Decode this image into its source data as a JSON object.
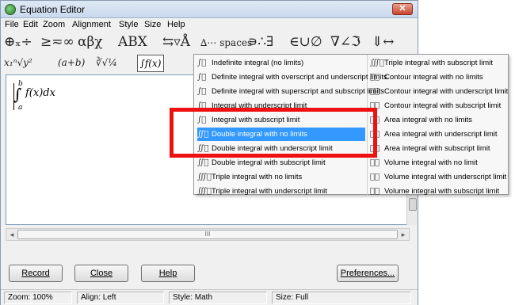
{
  "window": {
    "title": "Equation Editor",
    "close_label": "✕"
  },
  "menubar": [
    "File",
    "Edit",
    "Zoom",
    "Alignment",
    "Style",
    "Size",
    "Help"
  ],
  "palette_row1": [
    "⊕ₓ÷",
    "≥≂∞",
    "αβχ",
    "ΑΒΧ",
    "⇆▿Å",
    "∆⋯ spaces",
    "∍∴∃",
    "∈∪∅",
    "∇∠ℑ",
    "⇓↔"
  ],
  "palette_row2": [
    "x₁ⁿ√y²",
    "(a+b)",
    "∛√¼",
    "∫f(x)"
  ],
  "editor": {
    "integral": "∫",
    "upper": "b",
    "lower": "a",
    "body": "f(x)dx"
  },
  "hscroll_thumb": "III",
  "buttons": {
    "record": "Record",
    "close": "Close",
    "help": "Help",
    "preferences": "Preferences..."
  },
  "status": {
    "zoom": "Zoom: 100%",
    "align": "Align: Left",
    "style": "Style: Math",
    "size": "Size: Full"
  },
  "dropdown": {
    "left_column": [
      {
        "glyph": "∫⃞",
        "label": "Indefinite integral (no limits)"
      },
      {
        "glyph": "∫⃞",
        "label": "Definite integral with overscript and underscript limits"
      },
      {
        "glyph": "∫⃞",
        "label": "Definite integral with superscript and subscript limits"
      },
      {
        "glyph": "∫⃞",
        "label": "Integral with underscript limit"
      },
      {
        "glyph": "∫⃞",
        "label": "Integral with subscript limit"
      },
      {
        "glyph": "∬⃞",
        "label": "Double integral with no limits"
      },
      {
        "glyph": "∬⃞",
        "label": "Double integral with underscript limit"
      },
      {
        "glyph": "∬⃞",
        "label": "Double integral with subscript limit"
      },
      {
        "glyph": "∭⃞",
        "label": "Triple integral with no limits"
      },
      {
        "glyph": "∭⃞",
        "label": "Triple integral with underscript limit"
      }
    ],
    "right_column": [
      {
        "glyph": "∭⃞",
        "label": "Triple integral with subscript limit"
      },
      {
        "glyph": "∮⃞",
        "label": "Contour integral with no limits"
      },
      {
        "glyph": "∮⃞",
        "label": "Contour integral with underscript limit"
      },
      {
        "glyph": "∮⃞",
        "label": "Contour integral with subscript limit"
      },
      {
        "glyph": "∯⃞",
        "label": "Area integral with no limits"
      },
      {
        "glyph": "∯⃞",
        "label": "Area integral with underscript limit"
      },
      {
        "glyph": "∯⃞",
        "label": "Area integral with subscript limit"
      },
      {
        "glyph": "∰⃞",
        "label": "Volume integral with no limit"
      },
      {
        "glyph": "∰⃞",
        "label": "Volume integral with underscript limit"
      },
      {
        "glyph": "∰⃞",
        "label": "Volume integral with subscript limit"
      }
    ],
    "selected_index": 5
  },
  "colors": {
    "highlight_box": "#ee1111",
    "selection": "#3399ff"
  }
}
